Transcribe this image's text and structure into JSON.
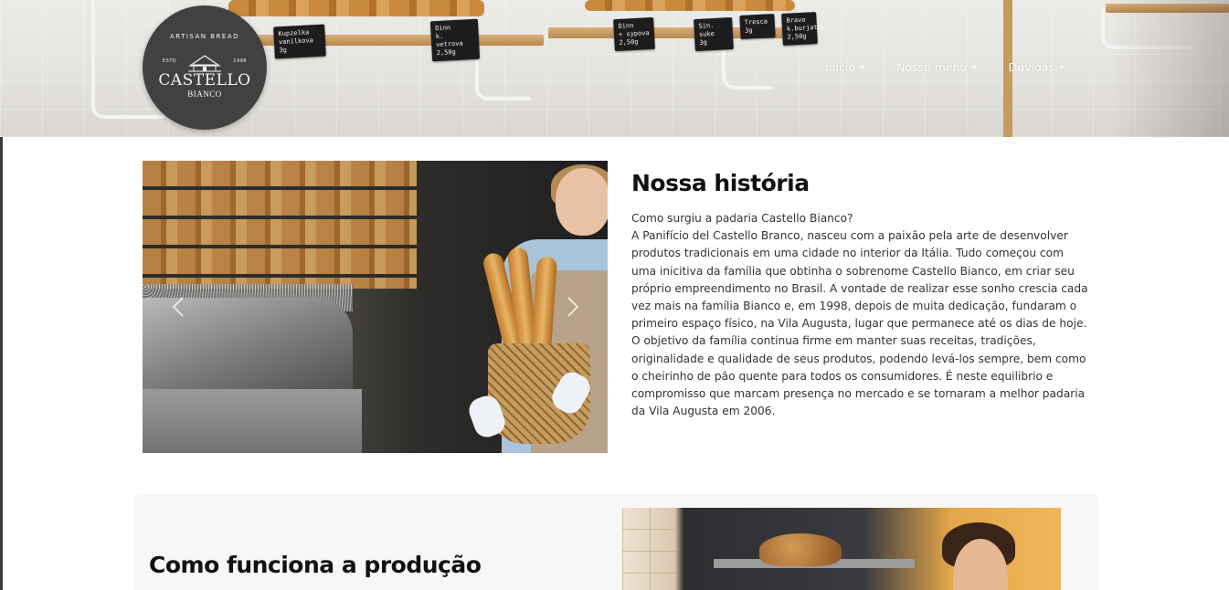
{
  "logo": {
    "tagline": "ARTISAN BREAD",
    "estd_label": "ESTD",
    "estd_year": "1998",
    "name": "CASTELLO",
    "sub": "BIANCO"
  },
  "nav": {
    "items": [
      {
        "label": "Início"
      },
      {
        "label": "Nosso menu"
      },
      {
        "label": "Dúvidas"
      }
    ]
  },
  "hero": {
    "signs": [
      "Kupzelka\nvanilkova\n3g",
      "Dinn\nk. vetrova\n2,50g",
      "Dinn\n+ sypova\n2,50g",
      "Sin. suke\n3g",
      "Tresca\n3g",
      "Bravo\nk.burjatovo\n2,50g"
    ]
  },
  "about": {
    "carousel": {
      "prev_icon": "chevron-left-icon",
      "next_icon": "chevron-right-icon"
    },
    "title": "Nossa história",
    "question": "Como surgiu a padaria Castello Bianco?",
    "body": "A Panifício del Castello Branco, nasceu com a paixão pela arte de desenvolver produtos tradicionais em uma cidade no interior da Itália. Tudo começou com uma inicitiva da família que obtinha o sobrenome Castello Bianco, em criar seu próprio empreendimento no Brasil. A vontade de realizar esse sonho crescia cada vez mais na família Bianco e, em 1998, depois de muita dedicação, fundaram o primeiro espaço físico, na Vila Augusta, lugar que permanece até os dias de hoje. O objetivo da família continua firme em manter suas receitas, tradições, originalidade e qualidade de seus produtos, podendo levá-los sempre, bem como o cheirinho de pão quente para todos os consumidores. É neste equilibrio e compromisso que marcam presença no mercado e se tornaram a melhor padaria da Vila Augusta em 2006."
  },
  "production": {
    "title": "Como funciona a produção"
  },
  "colors": {
    "logo_bg": "#414141",
    "text_primary": "#111111",
    "section_bg": "#f7f7f7"
  }
}
